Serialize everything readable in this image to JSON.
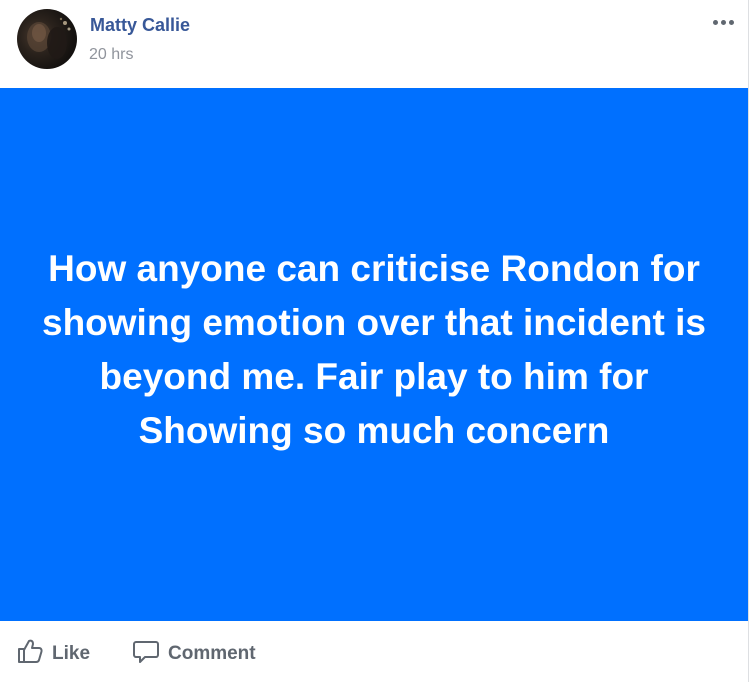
{
  "post": {
    "author": "Matty Callie",
    "timestamp": "20 hrs",
    "text": "How anyone can criticise Rondon for showing emotion over that incident is beyond me. Fair play to him for Showing so much concern",
    "background_color": "#0070ff",
    "text_color": "#ffffff"
  },
  "menu": {
    "icon": "more-options-icon"
  },
  "actions": {
    "like_label": "Like",
    "like_icon": "thumbs-up-icon",
    "comment_label": "Comment",
    "comment_icon": "speech-bubble-icon"
  },
  "colors": {
    "author_link": "#385898",
    "muted_text": "#90949c",
    "action_text": "#606770"
  }
}
